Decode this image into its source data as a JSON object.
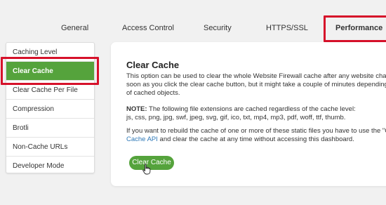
{
  "tabs": [
    {
      "label": "General"
    },
    {
      "label": "Access Control"
    },
    {
      "label": "Security"
    },
    {
      "label": "HTTPS/SSL"
    },
    {
      "label": "Performance"
    }
  ],
  "sidebar": {
    "items": [
      {
        "label": "Caching Level"
      },
      {
        "label": "Clear Cache"
      },
      {
        "label": "Clear Cache Per File"
      },
      {
        "label": "Compression"
      },
      {
        "label": "Brotli"
      },
      {
        "label": "Non-Cache URLs"
      },
      {
        "label": "Developer Mode"
      }
    ]
  },
  "main": {
    "title": "Clear Cache",
    "desc_line1": "This option can be used to clear the whole Website Firewall cache after any website chan",
    "desc_line2": "soon as you click the clear cache button, but it might take a couple of minutes depending",
    "desc_line3": "of cached objects.",
    "note_label": "NOTE:",
    "note_text": " The following file extensions are cached regardless of the cache level:",
    "extensions": "js, css, png, jpg, swf, jpeg, svg, gif, ico, txt, mp4, mp3, pdf, woff, ttf, thumb.",
    "rebuild_line1": "If you want to rebuild the cache of one or more of these static files you have to use the \"C",
    "rebuild_link": "Cache API",
    "rebuild_line2_rest": " and clear the cache at any time without accessing this dashboard.",
    "button_label": "Clear Cache"
  },
  "colors": {
    "accent_green": "#55a33c",
    "highlight_red": "#d6112a",
    "link_blue": "#2e78b7"
  }
}
